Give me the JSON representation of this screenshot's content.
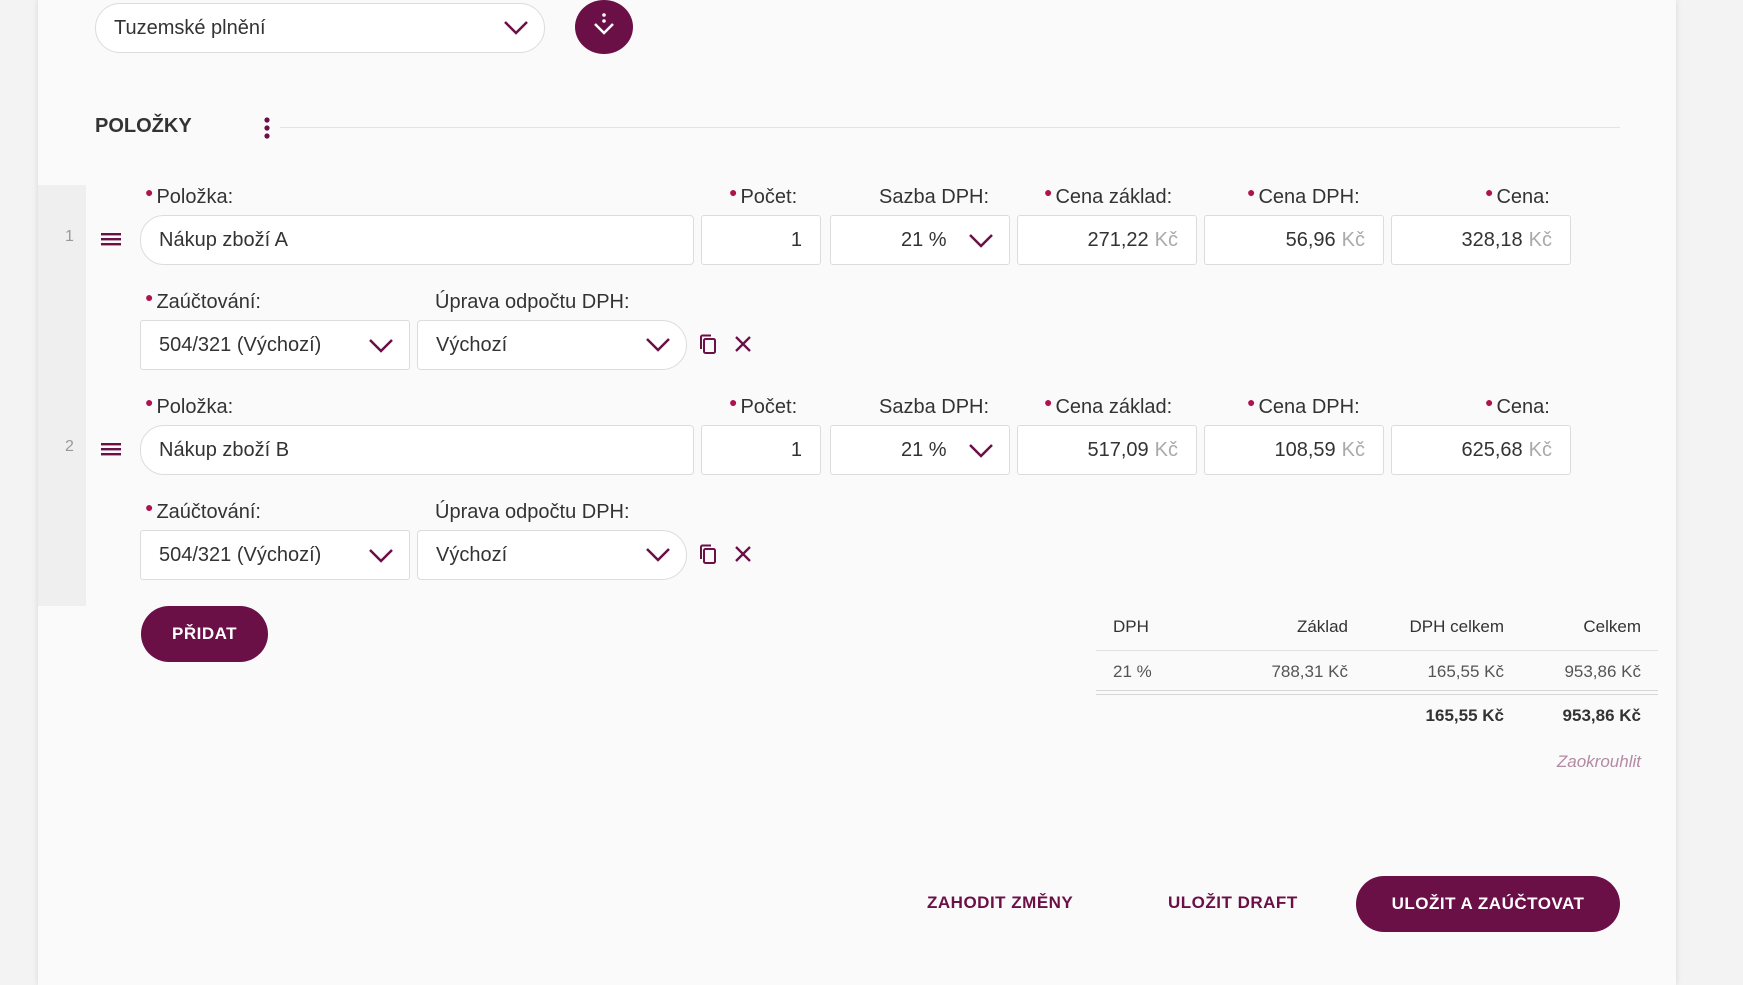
{
  "colors": {
    "accent": "#6b0f47",
    "required_dot": "#b0124e",
    "link": "#b28aa3"
  },
  "top": {
    "vat_mode_select": "Tuzemské plnění"
  },
  "section": {
    "title": "POLOŽKY"
  },
  "labels": {
    "item": "Položka:",
    "count": "Počet:",
    "vat_rate": "Sazba DPH:",
    "base_price": "Cena základ:",
    "vat_price": "Cena DPH:",
    "price": "Cena:",
    "accounting": "Zaúčtování:",
    "vat_adjust": "Úprava odpočtu DPH:"
  },
  "items": [
    {
      "index": "1",
      "name": "Nákup zboží A",
      "count": "1",
      "vat_rate": "21 %",
      "base": "271,22",
      "vat": "56,96",
      "price": "328,18",
      "currency": "Kč",
      "accounting": "504/321 (Výchozí)",
      "vat_adjust": "Výchozí"
    },
    {
      "index": "2",
      "name": "Nákup zboží B",
      "count": "1",
      "vat_rate": "21 %",
      "base": "517,09",
      "vat": "108,59",
      "price": "625,68",
      "currency": "Kč",
      "accounting": "504/321 (Výchozí)",
      "vat_adjust": "Výchozí"
    }
  ],
  "add_button": "PŘIDAT",
  "summary": {
    "headers": [
      "DPH",
      "Základ",
      "DPH celkem",
      "Celkem"
    ],
    "row": [
      "21 %",
      "788,31 Kč",
      "165,55 Kč",
      "953,86 Kč"
    ],
    "total_vat": "165,55 Kč",
    "total": "953,86 Kč",
    "round_link": "Zaokrouhlit"
  },
  "actions": {
    "discard": "ZAHODIT ZMĚNY",
    "save_draft": "ULOŽIT DRAFT",
    "save_post": "ULOŽIT A ZAÚČTOVAT"
  }
}
